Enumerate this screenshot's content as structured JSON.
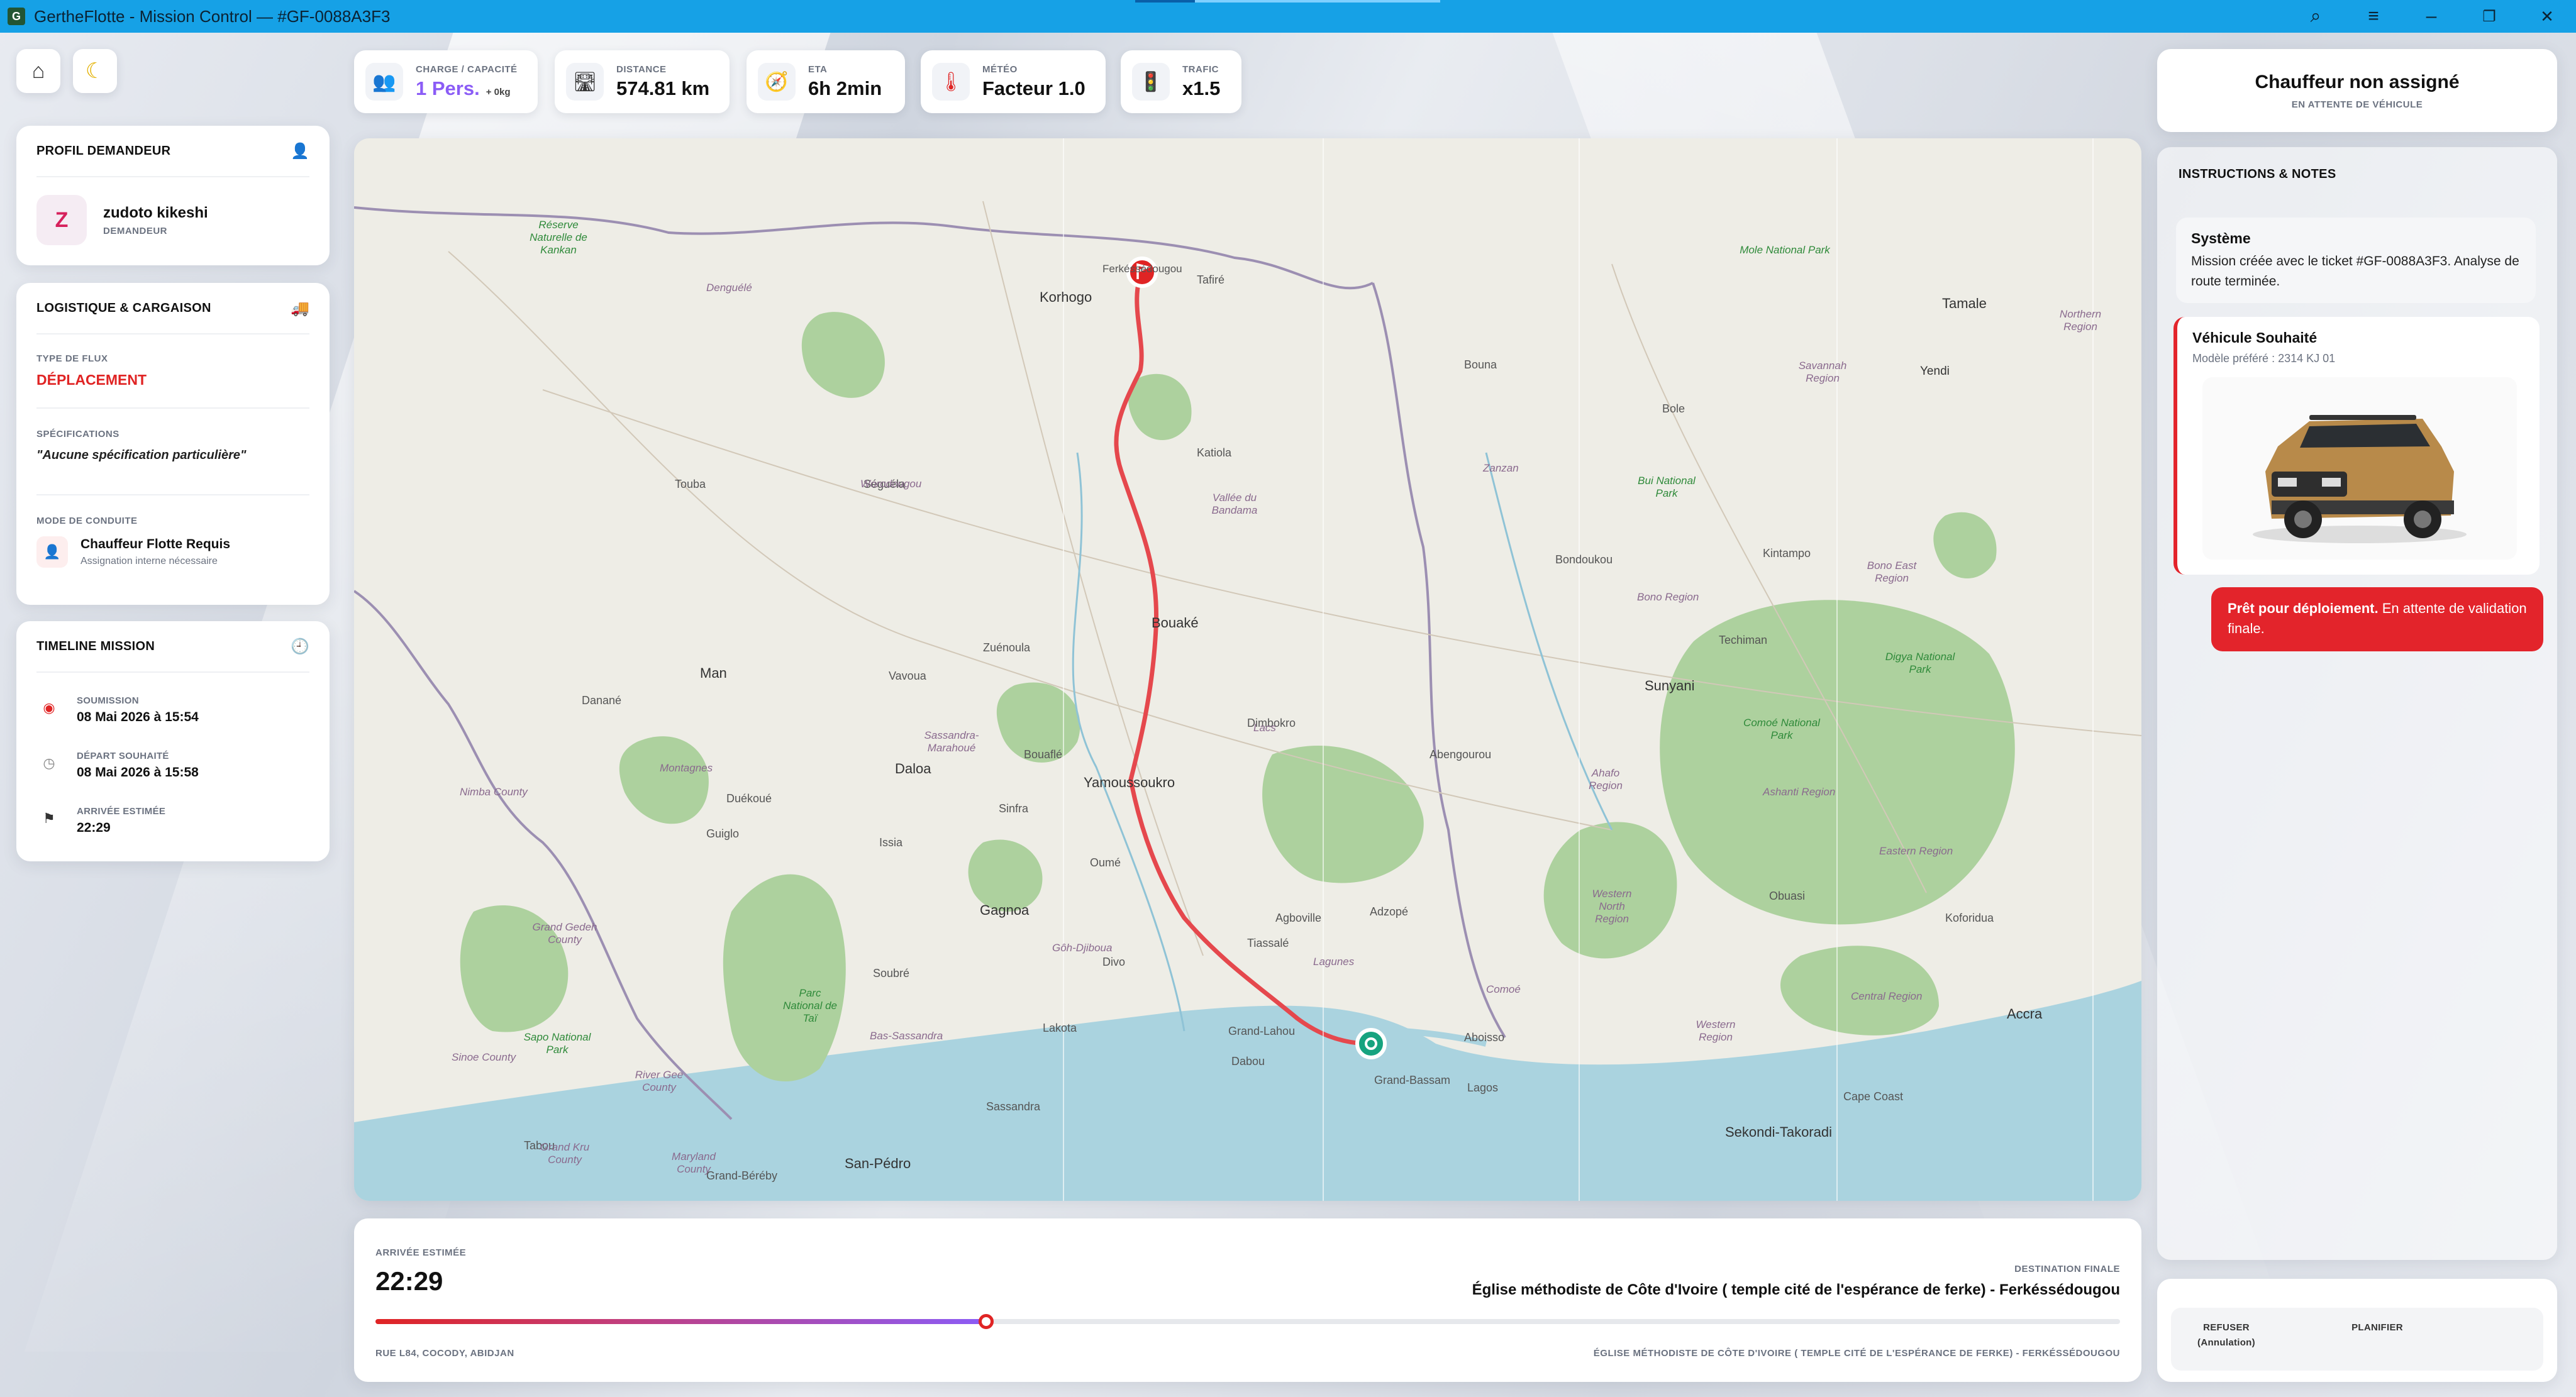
{
  "window": {
    "app_icon": "G",
    "title": "GertheFlotte - Mission Control — #GF-0088A3F3",
    "controls": {
      "search": "⌕",
      "menu": "≡",
      "minimize": "–",
      "restore": "❐",
      "close": "✕"
    }
  },
  "topbar": {
    "home_icon": "⌂",
    "theme_icon": "☾"
  },
  "stats": [
    {
      "label": "CHARGE / CAPACITÉ",
      "value": "1 Pers.",
      "sub": "+ 0kg",
      "icon": "👥"
    },
    {
      "label": "DISTANCE",
      "value": "574.81 km",
      "icon": "🛣"
    },
    {
      "label": "ETA",
      "value": "6h 2min",
      "icon": "🧭"
    },
    {
      "label": "MÉTÉO",
      "value": "Facteur 1.0",
      "icon": "🌡"
    },
    {
      "label": "TRAFIC",
      "value": "x1.5",
      "icon": "🚦"
    }
  ],
  "profile": {
    "title": "PROFIL DEMANDEUR",
    "icon": "👤",
    "avatar_letter": "Z",
    "name": "zudoto kikeshi",
    "role": "DEMANDEUR"
  },
  "logistics": {
    "title": "LOGISTIQUE & CARGAISON",
    "icon": "🚚",
    "flow_label": "TYPE DE FLUX",
    "flow_value": "DÉPLACEMENT",
    "spec_label": "SPÉCIFICATIONS",
    "spec_value": "\"Aucune spécification particulière\"",
    "mode_label": "MODE DE CONDUITE",
    "mode_icon": "👤",
    "mode_value": "Chauffeur Flotte Requis",
    "mode_sub": "Assignation interne nécessaire"
  },
  "timeline": {
    "title": "TIMELINE MISSION",
    "icon": "🕘",
    "items": [
      {
        "label": "SOUMISSION",
        "value": "08 Mai 2026 à 15:54",
        "icon": "◉"
      },
      {
        "label": "DÉPART SOUHAITÉ",
        "value": "08 Mai 2026 à 15:58",
        "icon": "◷"
      },
      {
        "label": "ARRIVÉE ESTIMÉE",
        "value": "22:29",
        "icon": "⚑"
      }
    ]
  },
  "map": {
    "labels": {
      "korhogo": "Korhogo",
      "ferke": "Ferkéssédougou",
      "tamale": "Tamale",
      "bouake": "Bouaké",
      "yamoussoukro": "Yamoussoukro",
      "daloa": "Daloa",
      "gagnoa": "Gagnoa",
      "man": "Man",
      "sunyani": "Sunyani",
      "accra": "Accra",
      "sanpedro": "San-Pédro",
      "sekondi": "Sekondi-Takoradi",
      "grandbassam": "Grand-Bassam",
      "bondoukou": "Bondoukou",
      "abengourou": "Abengourou",
      "dabou": "Dabou",
      "agboville": "Agboville",
      "dimbokro": "Dimbokro",
      "bouafle": "Bouaflé",
      "divo": "Divo",
      "soubre": "Soubré",
      "oume": "Oumé",
      "sinfra": "Sinfra",
      "issia": "Issia",
      "duekoue": "Duékoué",
      "guiglo": "Guiglo",
      "danane": "Danané",
      "techiman": "Techiman",
      "kintampo": "Kintampo",
      "obuasi": "Obuasi",
      "capecoast": "Cape Coast",
      "koforidua": "Koforidua",
      "bole": "Bole",
      "tafire": "Tafiré",
      "bouna": "Bouna",
      "seguela": "Séguéla",
      "touba": "Touba",
      "katiola": "Katiola",
      "vavoua": "Vavoua",
      "zuenoula": "Zuénoula",
      "tiassale": "Tiassalé",
      "adzope": "Adzopé",
      "aboisso": "Aboisso",
      "tabou": "Tabou",
      "sassandra": "Sassandra",
      "lakota": "Lakota",
      "grandlahou": "Grand-Lahou",
      "lagos": "Lagos",
      "grandbereby": "Grand-Béréby",
      "mole": "Mole National Park",
      "kankan": "Réserve Naturelle de Kankan",
      "comoe": "Comoé National Park",
      "tai": "Parc National de Taï",
      "bui": "Bui National Park",
      "digya": "Digya National Park",
      "ashanti": "Ashanti Region",
      "bono": "Bono Region",
      "bonoeast": "Bono East Region",
      "western": "Western Region",
      "central": "Central Region",
      "eastern": "Eastern Region",
      "savannah": "Savannah Region",
      "ahafo": "Ahafo Region",
      "westernnorth": "Western North Region",
      "gbeke": "Vallée du Bandama",
      "zanzan": "Zanzan",
      "nimba": "Nimba County",
      "grandgedeh": "Grand Gedeh County",
      "rivergee": "River Gee County",
      "sinoe": "Sinoe County",
      "grandkru": "Grand Kru County",
      "maryland": "Maryland County",
      "sapo": "Sapo National Park",
      "denguele": "Denguélé",
      "worodougou": "Worodougou",
      "sassandra_marahoue": "Sassandra-Marahoué",
      "lagunes": "Lagunes",
      "yendi": "Yendi",
      "northern": "Northern Region",
      "comoe_dist": "Comoé",
      "montagnes": "Montagnes",
      "goh": "Gôh-Djiboua",
      "bassassandra": "Bas-Sassandra",
      "lacs": "Lacs"
    },
    "route_color": "#e5484d",
    "origin_color": "#16a37f",
    "destination_color": "#e02424"
  },
  "bottom": {
    "eta_label": "ARRIVÉE ESTIMÉE",
    "eta_value": "22:29",
    "dest_label": "DESTINATION FINALE",
    "dest_value": "Église méthodiste de Côte d'Ivoire ( temple cité de l'espérance de ferke) - Ferkéssédougou",
    "progress": 0.35,
    "origin_addr": "RUE L84, COCODY, ABIDJAN",
    "dest_addr": "ÉGLISE MÉTHODISTE DE CÔTE D'IVOIRE ( TEMPLE CITÉ DE L'ESPÉRANCE DE FERKE) - FERKÉSSÉDOUGOU"
  },
  "driver": {
    "title": "Chauffeur non assigné",
    "subtitle": "EN ATTENTE DE VÉHICULE"
  },
  "notes": {
    "title": "INSTRUCTIONS & NOTES",
    "system_title": "Système",
    "system_text": "Mission créée avec le ticket #GF-0088A3F3. Analyse de route terminée.",
    "vehicle_title": "Véhicule Souhaité",
    "vehicle_sub": "Modèle préféré : 2314 KJ 01",
    "ready_bold": "Prêt pour déploiement.",
    "ready_text": "En attente de validation finale.",
    "accent": "#e3242b"
  },
  "actions": {
    "refuse": "REFUSER",
    "refuse_sub": "(Annulation)",
    "plan": "PLANIFIER"
  }
}
